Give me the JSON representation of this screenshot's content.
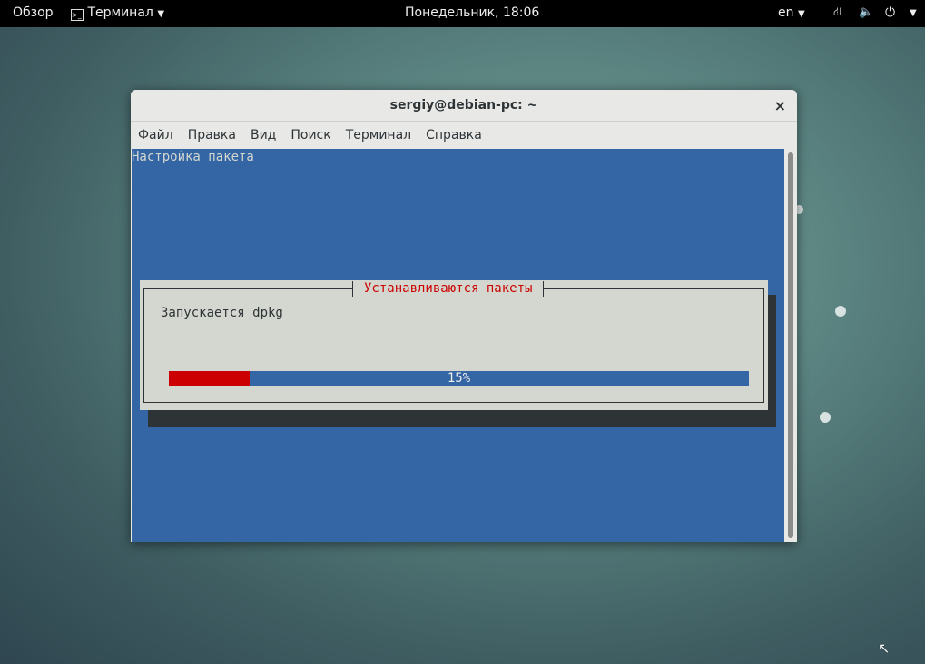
{
  "topbar": {
    "activities": "Обзор",
    "app_menu": "Терминал",
    "clock": "Понедельник, 18:06",
    "lang": "en"
  },
  "window": {
    "title": "sergiy@debian-pc: ~",
    "close": "×",
    "menu": [
      "Файл",
      "Правка",
      "Вид",
      "Поиск",
      "Терминал",
      "Справка"
    ]
  },
  "terminal": {
    "header": "Настройка пакета",
    "dialog": {
      "title": "Устанавливаются пакеты",
      "message": "Запускается dpkg",
      "progress_label": "15%",
      "progress": 0.14
    }
  }
}
